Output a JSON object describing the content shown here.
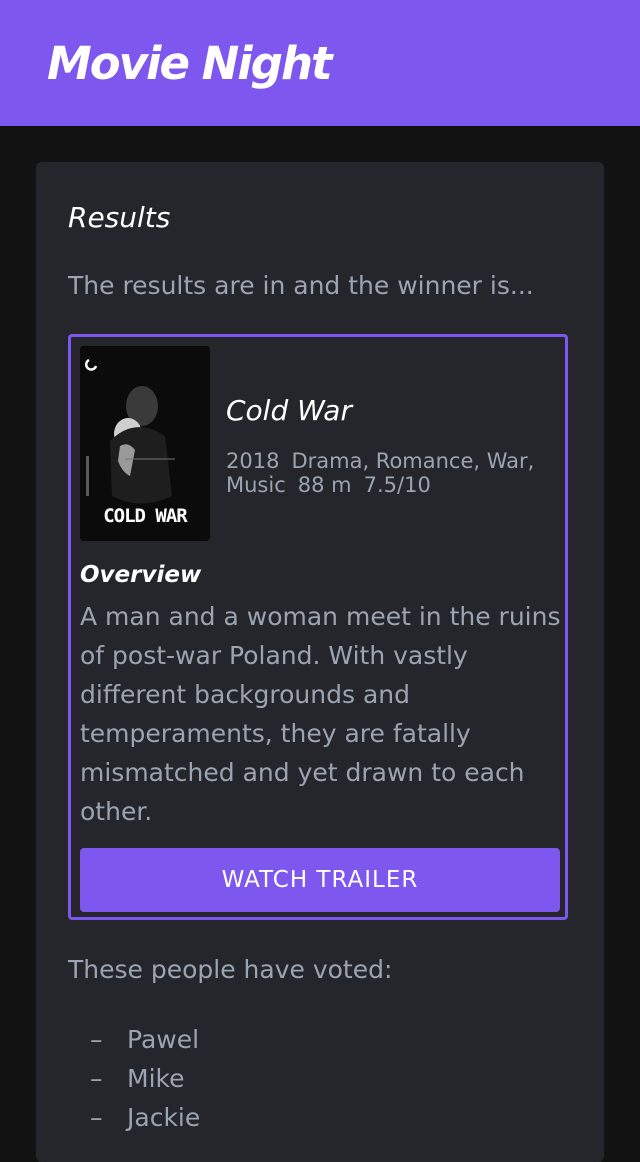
{
  "header": {
    "title": "Movie Night",
    "color": "#7e57ef"
  },
  "results": {
    "heading": "Results",
    "intro": "The results are in and the winner is..."
  },
  "movie": {
    "title": "Cold War",
    "poster_text": "COLD WAR",
    "year": "2018",
    "genres": "Drama, Romance, War, Music",
    "runtime": "88 m",
    "rating": "7.5/10",
    "overview_label": "Overview",
    "overview": "A man and a woman meet in the ruins of post-war Poland. With vastly different backgrounds and temperaments, they are fatally mismatched and yet drawn to each other.",
    "trailer_button": "WATCH TRAILER"
  },
  "voters": {
    "heading": "These people have voted:",
    "bullet": "–",
    "names": [
      "Pawel",
      "Mike",
      "Jackie"
    ]
  },
  "colors": {
    "accent": "#7e57ef",
    "background": "#121212",
    "card": "#25262b",
    "muted_text": "#9aa4b2"
  }
}
